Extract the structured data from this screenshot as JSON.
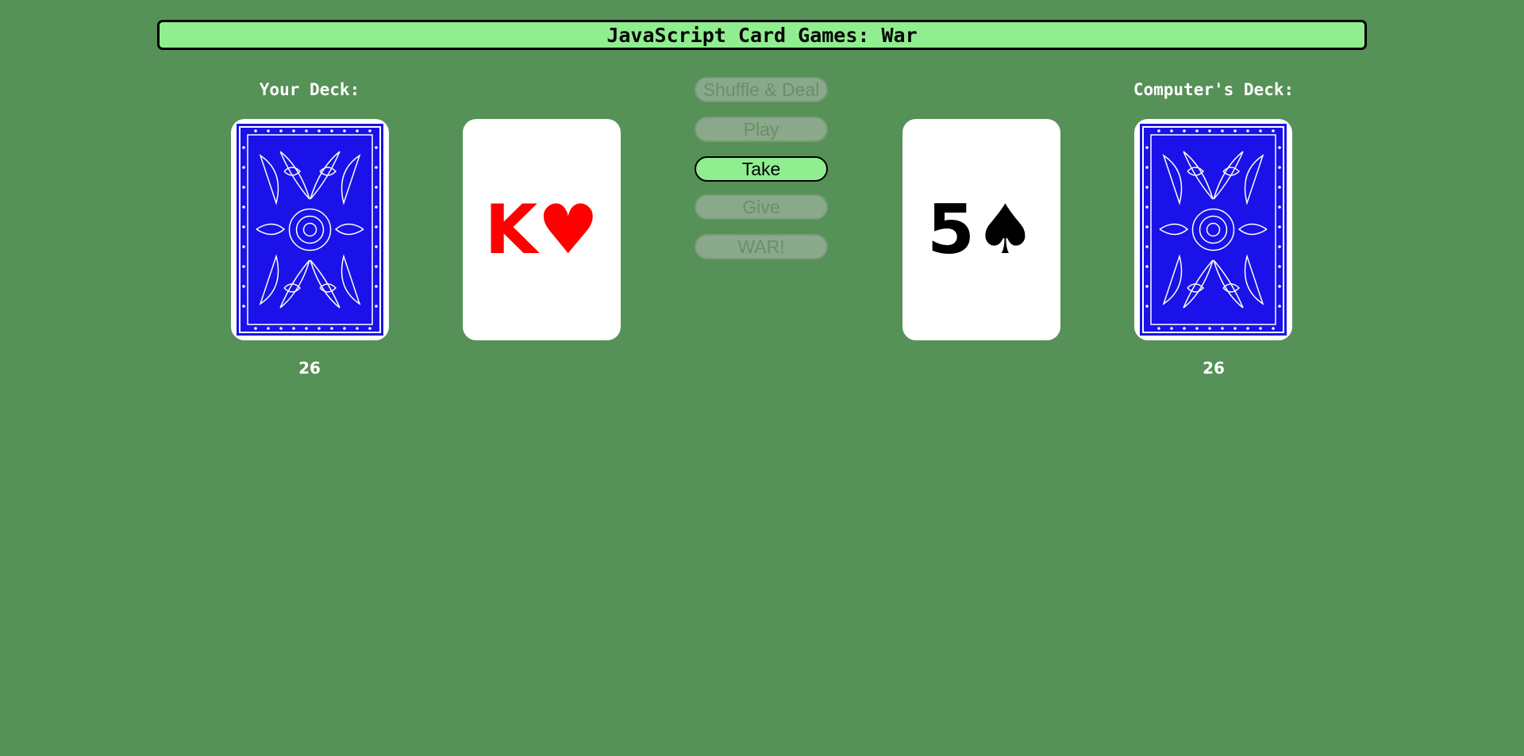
{
  "header": {
    "title": "JavaScript Card Games: War"
  },
  "player": {
    "label": "Your Deck:",
    "count": "26",
    "played_card": {
      "rank": "K",
      "suit": "♥",
      "color": "#ff0000"
    }
  },
  "computer": {
    "label": "Computer's Deck:",
    "count": "26",
    "played_card": {
      "rank": "5",
      "suit": "♠",
      "color": "#000000"
    }
  },
  "controls": {
    "shuffle_deal": {
      "label": "Shuffle & Deal",
      "enabled": false
    },
    "play": {
      "label": "Play",
      "enabled": false
    },
    "take": {
      "label": "Take",
      "enabled": true
    },
    "give": {
      "label": "Give",
      "enabled": false
    },
    "war": {
      "label": "WAR!",
      "enabled": false
    }
  },
  "colors": {
    "table": "#569157",
    "accent": "#90ee90",
    "card_back": "#1a12e8"
  },
  "icons": {
    "deck_back": "card-back-pattern-icon"
  }
}
